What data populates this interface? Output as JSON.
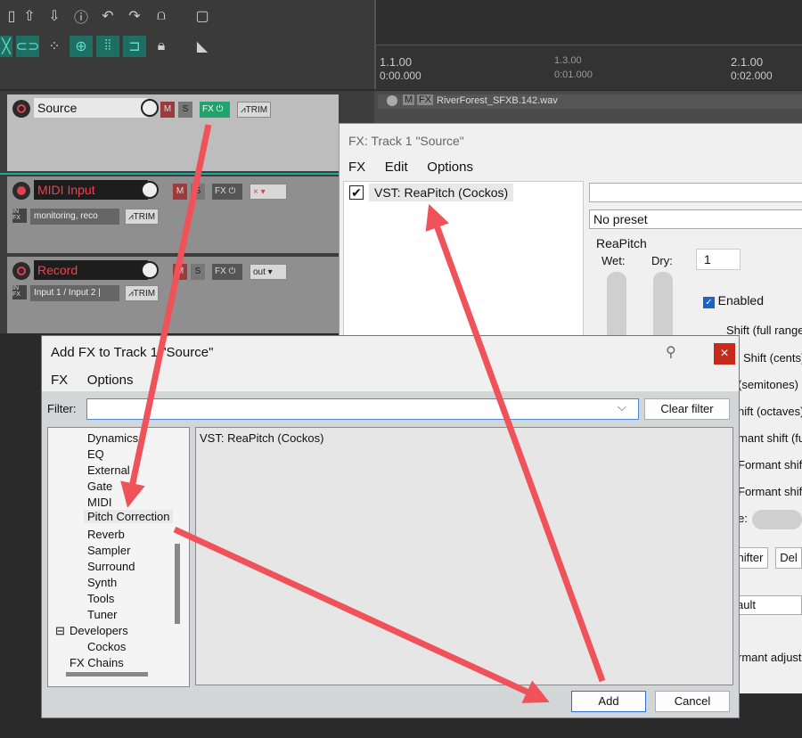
{
  "ruler": {
    "markers": [
      {
        "bar": "1.1.00",
        "time": "0:00.000"
      },
      {
        "bar": "1.3.00",
        "time": "0:01.000"
      },
      {
        "bar": "2.1.00",
        "time": "0:02.000"
      }
    ]
  },
  "tracks": [
    {
      "name": "Source",
      "fx": "FX",
      "trim": "TRIM",
      "m": "M",
      "s": "S"
    },
    {
      "name": "MIDI Input",
      "fx": "FX",
      "trim": "TRIM",
      "m": "M",
      "s": "S",
      "input": "monitoring, reco",
      "out": "×"
    },
    {
      "name": "Record",
      "fx": "FX",
      "trim": "TRIM",
      "m": "M",
      "s": "S",
      "input": "Input 1 / Input 2 |",
      "out": "out"
    }
  ],
  "item": {
    "filename": "RiverForest_SFXB.142.wav",
    "m": "M",
    "fx": "FX"
  },
  "fx_window": {
    "title": "FX: Track 1 \"Source\"",
    "menu": [
      "FX",
      "Edit",
      "Options"
    ],
    "plugin": "VST: ReaPitch (Cockos)",
    "preset": "No preset",
    "group_label": "ReaPitch",
    "wet_label": "Wet:",
    "dry_label": "Dry:",
    "tab": "1",
    "enabled": "Enabled",
    "params": [
      "Shift (full range",
      "Shift (cents)",
      "(semitones)",
      "hift (octaves)",
      "mant shift (full)",
      "Formant shif",
      "Formant shif"
    ],
    "shape_label": "e:",
    "shifter_btn": "hifter",
    "del_btn": "Del",
    "default_val": "ault",
    "formant_adjust": "rmant adjust"
  },
  "dialog": {
    "title": "Add FX to Track 1 \"Source\"",
    "menu": [
      "FX",
      "Options"
    ],
    "filter_label": "Filter:",
    "filter_value": "",
    "clear_filter": "Clear filter",
    "tree": [
      "Dynamics",
      "EQ",
      "External",
      "Gate",
      "MIDI",
      "Pitch Correction",
      "Reverb",
      "Sampler",
      "Surround",
      "Synth",
      "Tools",
      "Tuner"
    ],
    "developers": "Developers",
    "cockos": "Cockos",
    "fx_chains": "FX Chains",
    "result": "VST: ReaPitch (Cockos)",
    "add": "Add",
    "cancel": "Cancel",
    "close": "×"
  },
  "colors": {
    "arrow": "#f0525a",
    "record_red": "#ff3b45",
    "teal": "#1e6f62",
    "fx_green": "#21a36d"
  }
}
